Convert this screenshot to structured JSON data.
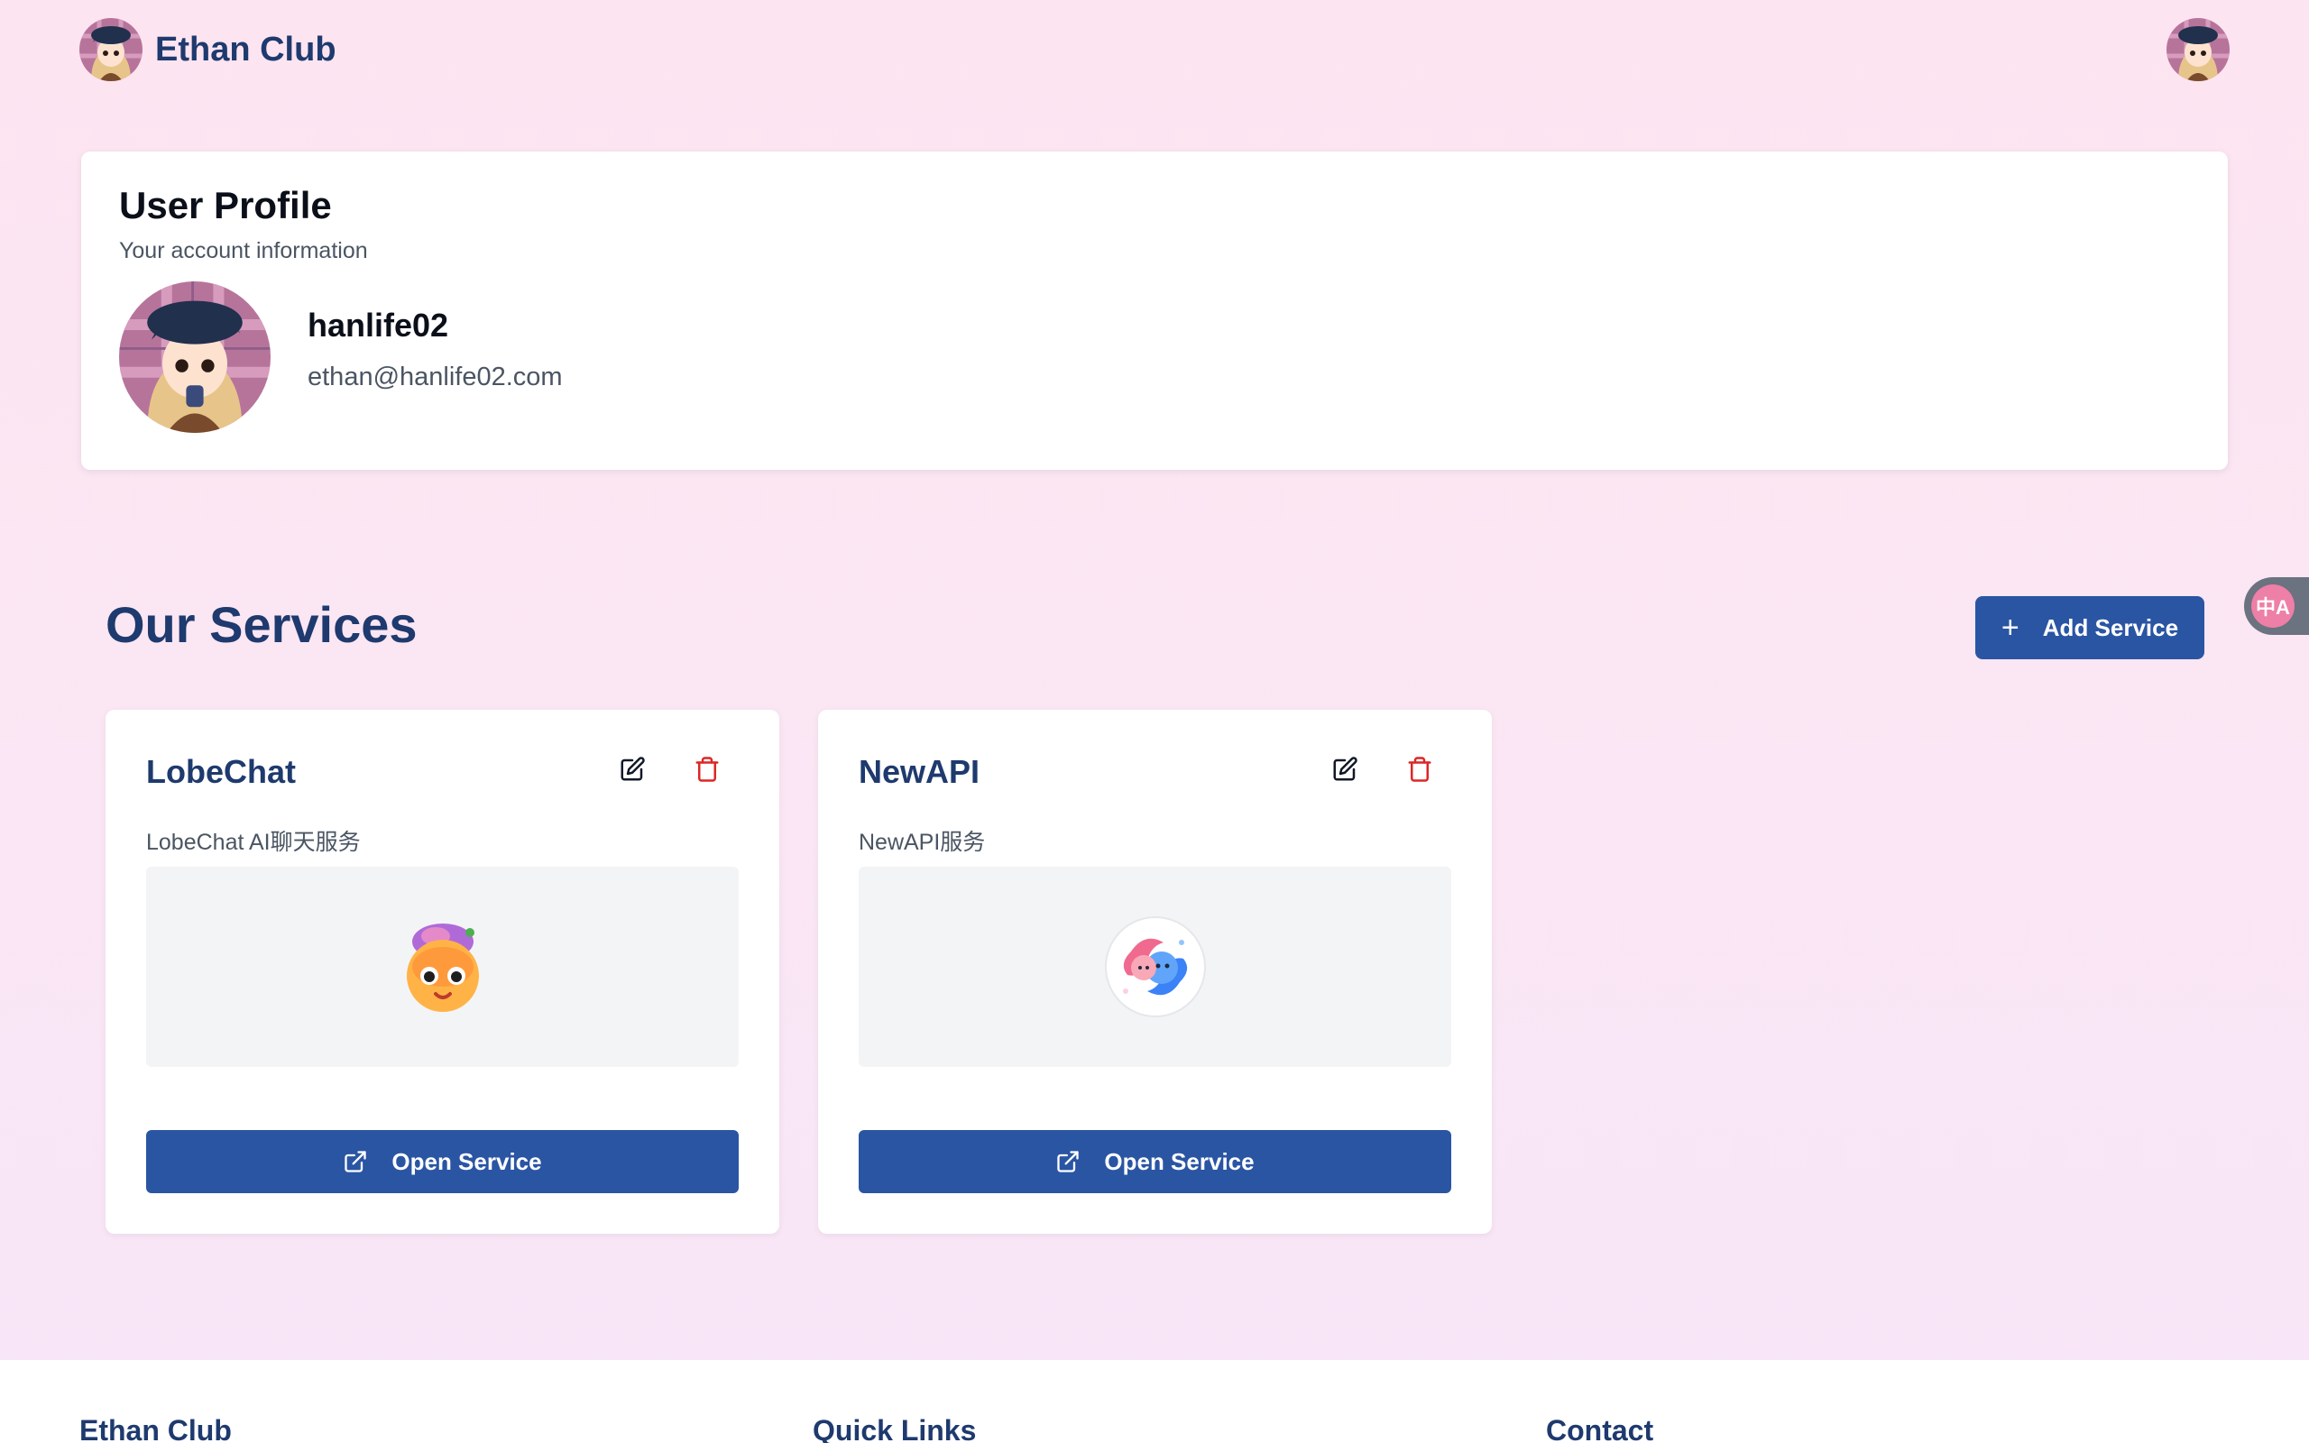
{
  "brand": {
    "name": "Ethan Club"
  },
  "profile": {
    "title": "User Profile",
    "subtitle": "Your account information",
    "username": "hanlife02",
    "email": "ethan@hanlife02.com"
  },
  "services_section": {
    "title": "Our Services",
    "add_label": "Add Service"
  },
  "translate_widget": {
    "icon": "translate-icon",
    "glyph": "中A"
  },
  "services": [
    {
      "name": "LobeChat",
      "description": "LobeChat AI聊天服务",
      "open_label": "Open Service",
      "icon": "lobechat-logo"
    },
    {
      "name": "NewAPI",
      "description": "NewAPI服务",
      "open_label": "Open Service",
      "icon": "newapi-logo"
    }
  ],
  "footer": {
    "col1": "Ethan Club",
    "col2": "Quick Links",
    "col3": "Contact"
  },
  "colors": {
    "primary": "#2a55a3",
    "heading": "#1e3a6e",
    "danger": "#dc2626",
    "background": "#fde4f1"
  }
}
